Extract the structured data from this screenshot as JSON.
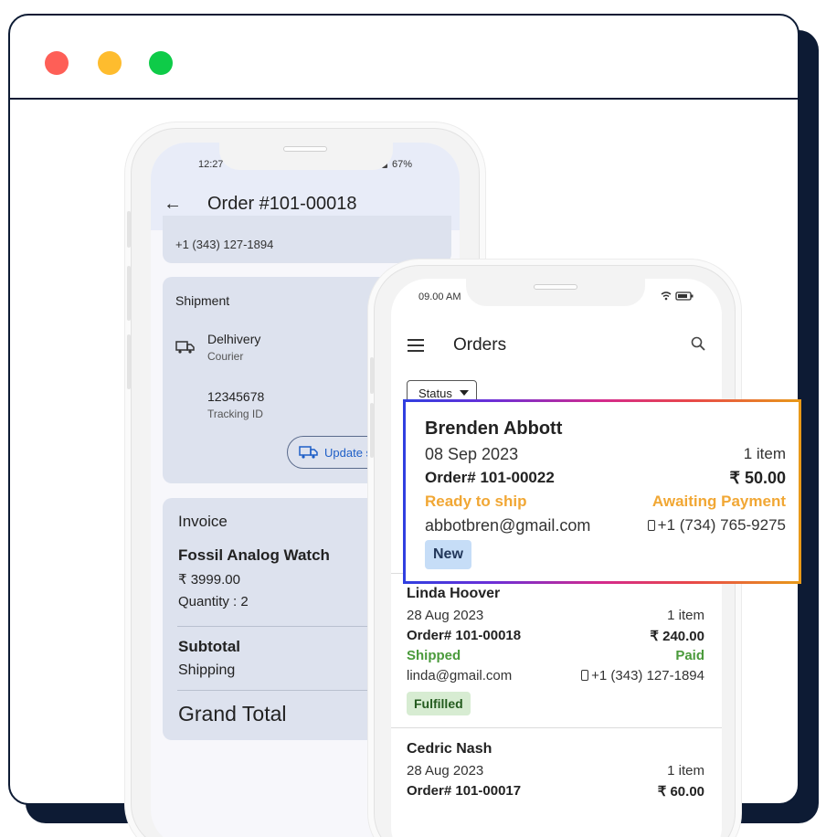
{
  "back_phone": {
    "status_time": "12:27",
    "status_battery": "67%",
    "title": "Order #101-00018",
    "customer_phone": "+1 (343) 127-1894",
    "shipment": {
      "heading": "Shipment",
      "courier_name": "Delhivery",
      "courier_label": "Courier",
      "tracking_id": "12345678",
      "tracking_label": "Tracking ID",
      "update_button": "Update s"
    },
    "invoice": {
      "heading": "Invoice",
      "product": "Fossil Analog Watch",
      "price": "₹ 3999.00",
      "quantity": "Quantity : 2",
      "subtotal": "Subtotal",
      "shipping": "Shipping",
      "grand_total": "Grand Total"
    }
  },
  "front_phone": {
    "status_time": "09.00 AM",
    "title": "Orders",
    "filter_label": "Status",
    "orders": [
      {
        "name": "Brenden Abbott",
        "date": "08 Sep 2023",
        "items": "1 item",
        "number": "Order# 101-00022",
        "amount": "₹ 50.00",
        "shipping_status": "Ready to ship",
        "payment_status": "Awaiting Payment",
        "email": "abbotbren@gmail.com",
        "phone": "+1 (734) 765-9275",
        "badge": "New"
      },
      {
        "name": "Linda Hoover",
        "date": "28 Aug 2023",
        "items": "1 item",
        "number": "Order# 101-00018",
        "amount": "₹ 240.00",
        "shipping_status": "Shipped",
        "payment_status": "Paid",
        "email": "linda@gmail.com",
        "phone": "+1 (343) 127-1894",
        "badge": "Fulfilled"
      },
      {
        "name": "Cedric Nash",
        "date": "28 Aug 2023",
        "items": "1 item",
        "number": "Order# 101-00017",
        "amount": "₹ 60.00"
      }
    ]
  },
  "colors": {
    "window_border": "#0d1b34",
    "awaiting": "#f1a734",
    "shipped": "#4a9a3b",
    "new_badge_bg": "#c6ddf7",
    "fulfilled_badge_bg": "#d7ecd2",
    "link_blue": "#1f5fc7"
  }
}
